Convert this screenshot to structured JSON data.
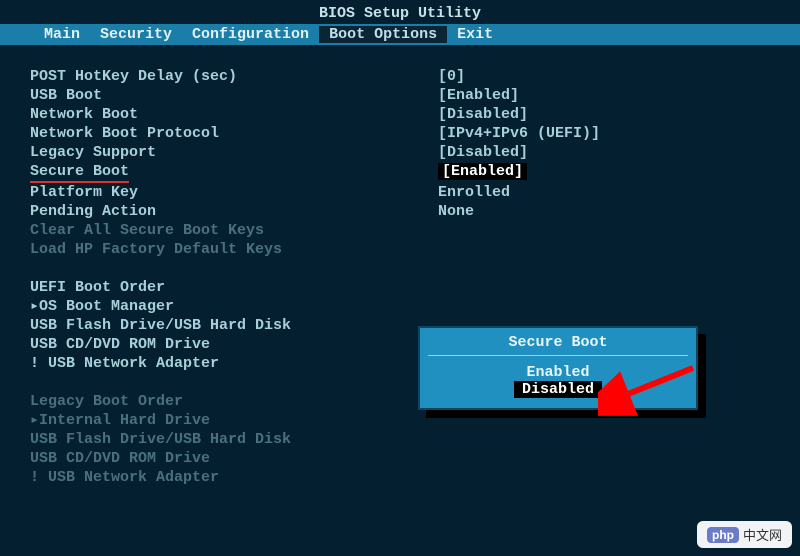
{
  "title": "BIOS Setup Utility",
  "menu": {
    "items": [
      "Main",
      "Security",
      "Configuration",
      "Boot Options",
      "Exit"
    ],
    "active_index": 3
  },
  "settings": [
    {
      "label": "POST HotKey Delay (sec)",
      "value": "[0]"
    },
    {
      "label": "USB Boot",
      "value": "[Enabled]"
    },
    {
      "label": "Network Boot",
      "value": "[Disabled]"
    },
    {
      "label": "Network Boot Protocol",
      "value": "[IPv4+IPv6 (UEFI)]"
    },
    {
      "label": "Legacy Support",
      "value": "[Disabled]"
    },
    {
      "label": "Secure Boot",
      "value": "[Enabled]",
      "label_underline": true,
      "value_highlight": true
    },
    {
      "label": "Platform Key",
      "value": "Enrolled"
    },
    {
      "label": "Pending Action",
      "value": "None"
    }
  ],
  "dim_actions": [
    "Clear All Secure Boot Keys",
    "Load HP Factory Default Keys"
  ],
  "uefi_section": {
    "header": "UEFI Boot Order",
    "items": [
      "▸OS Boot Manager",
      " USB Flash Drive/USB Hard Disk",
      " USB CD/DVD ROM Drive",
      " ! USB Network Adapter"
    ]
  },
  "legacy_section": {
    "header": "Legacy Boot Order",
    "items": [
      "▸Internal Hard Drive",
      " USB Flash Drive/USB Hard Disk",
      " USB CD/DVD ROM Drive",
      " ! USB Network Adapter"
    ]
  },
  "popup": {
    "title": "Secure Boot",
    "options": [
      "Enabled",
      "Disabled"
    ],
    "selected_index": 1
  },
  "watermark": {
    "logo": "php",
    "text": "中文网"
  }
}
